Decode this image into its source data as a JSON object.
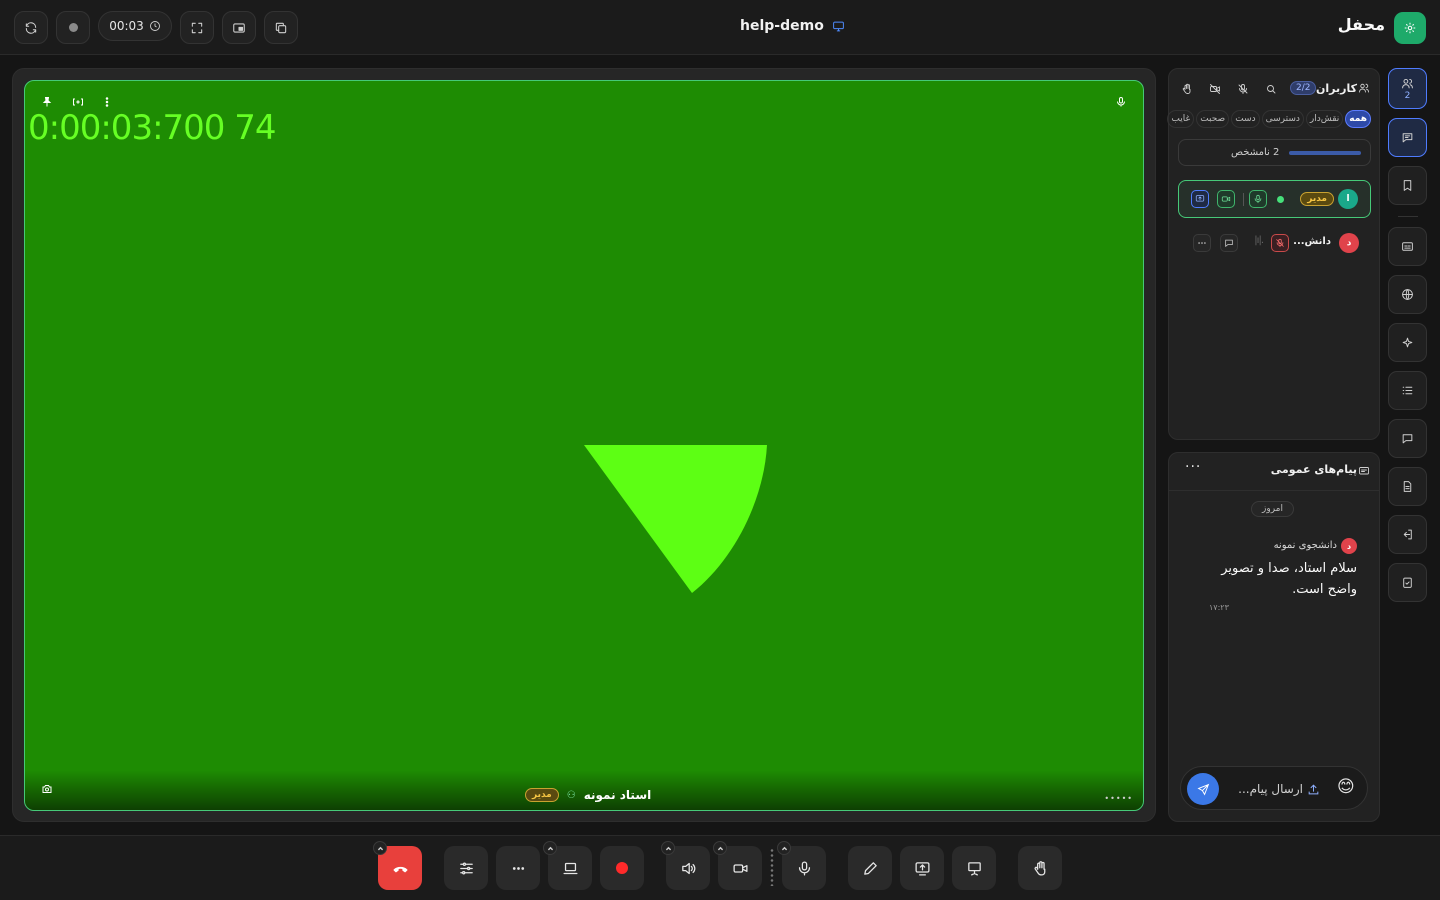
{
  "topbar": {
    "timer": "00:03",
    "room_name": "help-demo",
    "brand": "محفل"
  },
  "video": {
    "overlay_timestamp": "0:00:03:700 74",
    "participant_name": "استاد نمونه",
    "role_badge": "مدیر",
    "colors": {
      "background": "#1e8c03",
      "shape": "#5dff14",
      "border": "#46c978"
    }
  },
  "participants": {
    "title": "کاربران",
    "count": "2/2",
    "tabs": [
      "همه",
      "نقش‌دار",
      "دسترسی",
      "دست",
      "صحبت",
      "غایب"
    ],
    "unknown_label": "2 نامشخص",
    "users": [
      {
        "initial": "ا",
        "role": "مدیر",
        "avatar_color": "#1aa88a"
      },
      {
        "initial": "د",
        "name": "دانش...",
        "avatar_color": "#e0434b"
      }
    ]
  },
  "chat": {
    "title": "پیام‌های عمومی",
    "date_chip": "امروز",
    "messages": [
      {
        "sender": "دانشجوی نمونه",
        "sender_initial": "د",
        "text": "سلام استاد، صدا و تصویر واضح است.",
        "time": "۱۷:۲۳"
      }
    ],
    "input_placeholder": "ارسال پیام...",
    "emoji": "😊"
  },
  "rail": {
    "participants_count": "2"
  }
}
